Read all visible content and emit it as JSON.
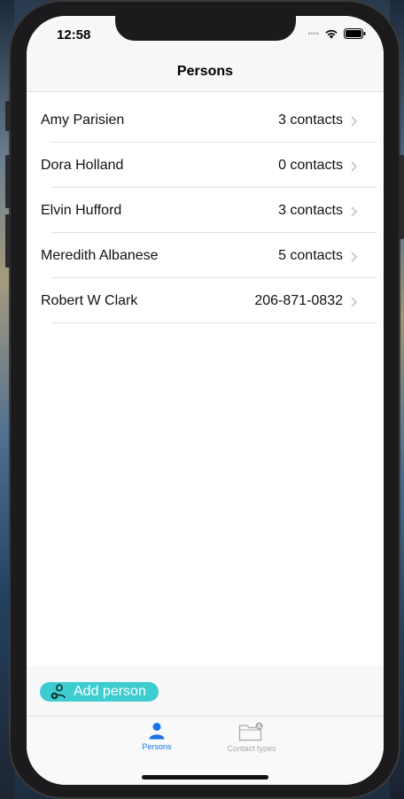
{
  "status_bar": {
    "time": "12:58",
    "signal_dots": "••••",
    "icons": [
      "wifi-icon",
      "battery-icon"
    ]
  },
  "nav": {
    "title": "Persons"
  },
  "persons": [
    {
      "name": "Amy Parisien",
      "detail": "3 contacts"
    },
    {
      "name": "Dora Holland",
      "detail": "0 contacts"
    },
    {
      "name": "Elvin Hufford",
      "detail": "3 contacts"
    },
    {
      "name": "Meredith Albanese",
      "detail": "5 contacts"
    },
    {
      "name": "Robert W Clark",
      "detail": "206-871-0832"
    }
  ],
  "actions": {
    "add_person_label": "Add person",
    "add_person_icon": "add-person-icon"
  },
  "tab_bar": {
    "tabs": [
      {
        "label": "Persons",
        "icon": "person-icon",
        "active": true
      },
      {
        "label": "Contact types",
        "icon": "contact-types-icon",
        "active": false
      }
    ]
  },
  "colors": {
    "accent": "#1a73e8",
    "add_button": "#3dcccf",
    "inactive_tab": "#a9a9ab"
  }
}
